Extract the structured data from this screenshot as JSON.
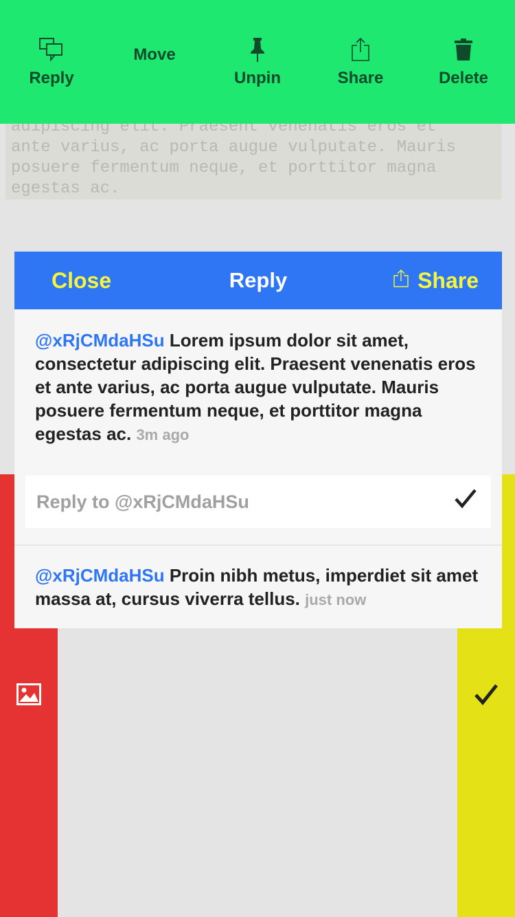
{
  "toolbar": {
    "items": [
      {
        "label": "Reply",
        "icon": "reply-bubbles-icon"
      },
      {
        "label": "Move",
        "icon": ""
      },
      {
        "label": "Unpin",
        "icon": "pin-icon"
      },
      {
        "label": "Share",
        "icon": "share-icon"
      },
      {
        "label": "Delete",
        "icon": "trash-icon"
      }
    ],
    "color": "#1fe870"
  },
  "background_note": {
    "text": "adipiscing elit. Praesent venenatis eros et\nante varius, ac porta augue vulputate. Mauris\nposuere fermentum neque, et porttitor magna\negestas ac."
  },
  "modal": {
    "header": {
      "close_label": "Close",
      "title": "Reply",
      "share_label": "Share",
      "color": "#2f76f5"
    },
    "original_message": {
      "user": "@xRjCMdaHSu",
      "text": " Lorem ipsum dolor sit amet, consectetur adipiscing elit. Praesent venenatis eros et ante varius, ac porta augue vulputate. Mauris posuere fermentum neque, et porttitor magna egestas ac. ",
      "time": "3m ago"
    },
    "reply_input": {
      "placeholder": "Reply to @xRjCMdaHSu"
    },
    "reply_message": {
      "user": "@xRjCMdaHSu",
      "text": " Proin nibh metus, imperdiet sit amet massa at, cursus viverra tellus. ",
      "time": "just now"
    }
  },
  "side_actions": {
    "left": {
      "icon": "image-icon",
      "color": "#e53232"
    },
    "right": {
      "icon": "checkmark-icon",
      "color": "#e4e117"
    }
  }
}
